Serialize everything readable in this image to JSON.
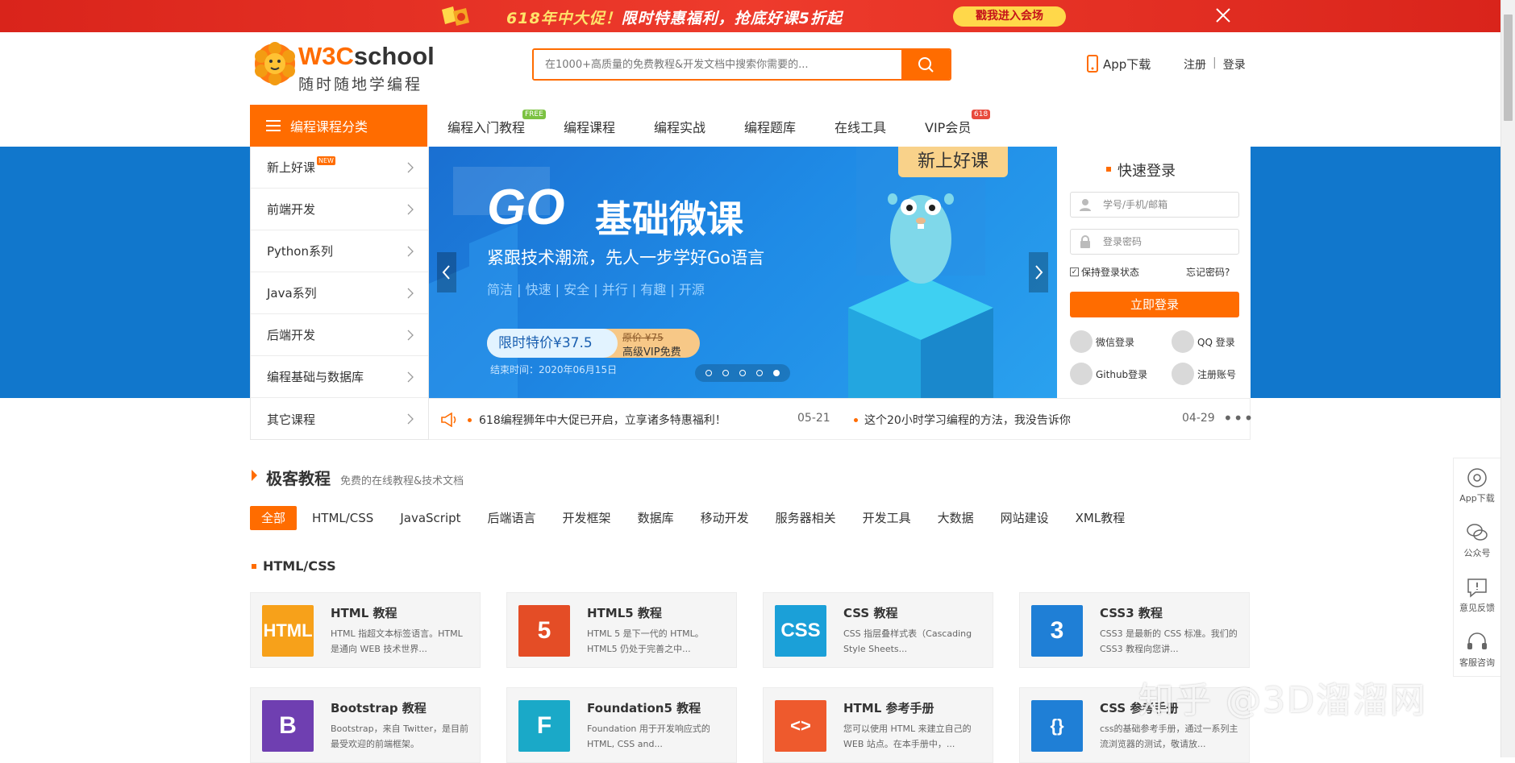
{
  "top_banner": {
    "promo_prefix": "618年中大促！",
    "promo_main": "限时特惠福利，抢底好课5折起",
    "enter_label": "戳我进入会场"
  },
  "header": {
    "logo_brand_a": "W3C",
    "logo_brand_b": "school",
    "logo_slogan": "随时随地学编程",
    "search_placeholder": "在1000+高质量的免费教程&开发文档中搜索你需要的...",
    "app_download": "App下载",
    "register": "注册",
    "divider": "|",
    "login": "登录"
  },
  "nav": {
    "category_button": "编程课程分类",
    "items": [
      {
        "label": "编程入门教程",
        "badge": "FREE"
      },
      {
        "label": "编程课程",
        "badge": ""
      },
      {
        "label": "编程实战",
        "badge": ""
      },
      {
        "label": "编程题库",
        "badge": ""
      },
      {
        "label": "在线工具",
        "badge": ""
      },
      {
        "label": "VIP会员",
        "badge": "618"
      }
    ]
  },
  "categories": [
    {
      "label": "新上好课",
      "badge": "NEW"
    },
    {
      "label": "前端开发"
    },
    {
      "label": "Python系列"
    },
    {
      "label": "Java系列"
    },
    {
      "label": "后端开发"
    },
    {
      "label": "编程基础与数据库"
    },
    {
      "label": "其它课程"
    }
  ],
  "banner": {
    "tag": "新上好课",
    "headline_go": "GO",
    "headline_rest": "基础微课",
    "subtitle": "紧跟技术潮流，先人一步学好Go语言",
    "features": "简洁 | 快速 | 安全 | 并行 | 有趣 | 开源",
    "price_label": "限时特价¥37.5",
    "original_price": "原价 ¥75",
    "vip_free": "高级VIP免费",
    "end_time": "结束时间：2020年06月15日",
    "dots": 5,
    "active_dot": 5
  },
  "login": {
    "title": "快速登录",
    "username_placeholder": "学号/手机/邮箱",
    "password_placeholder": "登录密码",
    "remember": "保持登录状态",
    "forgot": "忘记密码?",
    "submit": "立即登录",
    "wechat": "微信登录",
    "qq": "QQ 登录",
    "github": "Github登录",
    "register": "注册账号"
  },
  "notices": [
    {
      "text": "618编程狮年中大促已开启，立享诸多特惠福利！",
      "date": "05-21"
    },
    {
      "text": "这个20小时学习编程的方法，我没告诉你",
      "date": "04-29"
    }
  ],
  "tutorials_section": {
    "title": "极客教程",
    "subtitle": "免费的在线教程&技术文档",
    "tabs": [
      "全部",
      "HTML/CSS",
      "JavaScript",
      "后端语言",
      "开发框架",
      "数据库",
      "移动开发",
      "服务器相关",
      "开发工具",
      "大数据",
      "网站建设",
      "XML教程"
    ],
    "active_tab": 0,
    "group_title": "HTML/CSS",
    "cards": [
      {
        "title": "HTML 教程",
        "desc": "HTML 指超文本标签语言。HTML 是通向 WEB 技术世界...",
        "icon": "HTML",
        "color": "#f7a11a"
      },
      {
        "title": "HTML5 教程",
        "desc": "HTML 5 是下一代的 HTML。HTML5 仍处于完善之中...",
        "icon": "5",
        "color": "#e44d26"
      },
      {
        "title": "CSS 教程",
        "desc": "CSS 指层叠样式表（Cascading Style Sheets...",
        "icon": "CSS",
        "color": "#1ba0d8"
      },
      {
        "title": "CSS3 教程",
        "desc": "CSS3 是最新的 CSS 标准。我们的 CSS3 教程向您讲...",
        "icon": "3",
        "color": "#1f7fd6"
      },
      {
        "title": "Bootstrap 教程",
        "desc": "Bootstrap，来自 Twitter，是目前最受欢迎的前端框架。",
        "icon": "B",
        "color": "#6f3fb1"
      },
      {
        "title": "Foundation5 教程",
        "desc": "Foundation 用于开发响应式的 HTML, CSS and...",
        "icon": "F",
        "color": "#1aa9c8"
      },
      {
        "title": "HTML 参考手册",
        "desc": "您可以使用 HTML 来建立自己的 WEB 站点。在本手册中，...",
        "icon": "<>",
        "color": "#ee5a2d"
      },
      {
        "title": "CSS 参考手册",
        "desc": "css的基础参考手册，通过一系列主流浏览器的测试，敬请放...",
        "icon": "{}",
        "color": "#1f7fd6"
      }
    ]
  },
  "sidebar": [
    {
      "label": "App下载",
      "icon": "app-icon"
    },
    {
      "label": "公众号",
      "icon": "wechat-icon"
    },
    {
      "label": "意见反馈",
      "icon": "feedback-icon"
    },
    {
      "label": "客服咨询",
      "icon": "headset-icon"
    }
  ],
  "watermark": "知乎 @3D溜溜网"
}
